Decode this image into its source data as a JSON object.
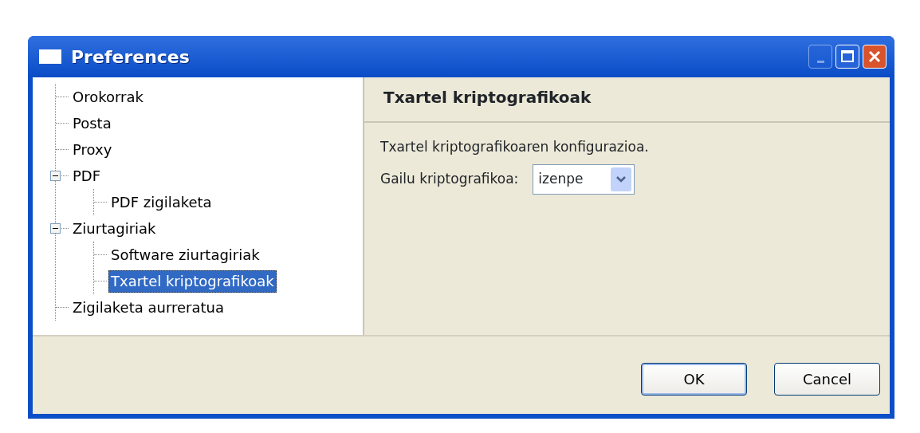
{
  "window": {
    "title": "Preferences"
  },
  "title_buttons": [
    {
      "kind": "minimize",
      "disabled": true
    },
    {
      "kind": "maximize",
      "disabled": false
    },
    {
      "kind": "close",
      "disabled": false
    }
  ],
  "tree": [
    {
      "label": "Orokorrak",
      "selected": false
    },
    {
      "label": "Posta",
      "selected": false
    },
    {
      "label": "Proxy",
      "selected": false
    },
    {
      "label": "PDF",
      "selected": false,
      "expanded": true,
      "children": [
        {
          "label": "PDF zigilaketa",
          "selected": false
        }
      ]
    },
    {
      "label": "Ziurtagiriak",
      "selected": false,
      "expanded": true,
      "children": [
        {
          "label": "Software ziurtagiriak",
          "selected": false
        },
        {
          "label": "Txartel kriptografikoak",
          "selected": true
        }
      ]
    },
    {
      "label": "Zigilaketa aurreratua",
      "selected": false
    }
  ],
  "panel": {
    "heading": "Txartel kriptografikoak",
    "description": "Txartel kriptografikoaren konfigurazioa.",
    "field_label": "Gailu kriptografikoa:",
    "field_value": "izenpe"
  },
  "buttons": [
    {
      "label": "OK",
      "default": true
    },
    {
      "label": "Cancel",
      "default": false
    }
  ]
}
